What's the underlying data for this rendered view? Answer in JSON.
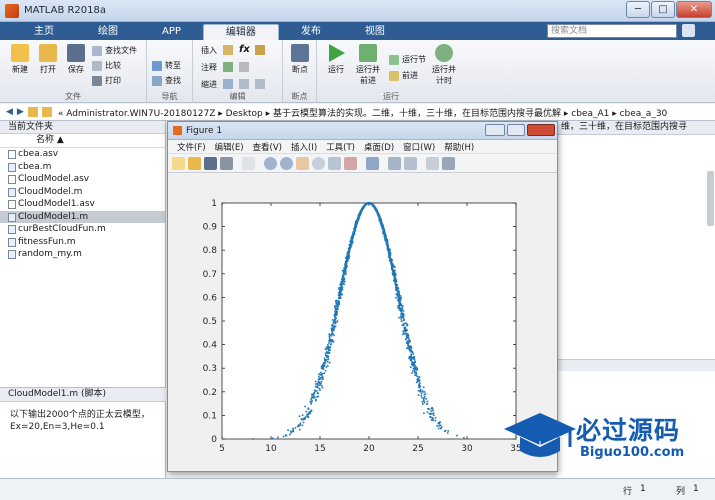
{
  "window": {
    "title": "MATLAB R2018a",
    "minimize": "─",
    "maximize": "□",
    "close": "✕"
  },
  "tabs": [
    "主页",
    "绘图",
    "APP",
    "编辑器",
    "发布",
    "视图"
  ],
  "search": {
    "placeholder": "搜索文档"
  },
  "ribbon": {
    "file": {
      "label": "文件",
      "new": "新建",
      "open": "打开",
      "save": "保存",
      "find_files": "查找文件",
      "compare": "比较",
      "print": "打印"
    },
    "navigate": {
      "label": "导航",
      "goto": "转至",
      "find": "查找"
    },
    "edit": {
      "label": "编辑",
      "insert": "插入",
      "comment": "注释",
      "indent": "缩进",
      "fx": "fx"
    },
    "breakpoints": {
      "label": "断点",
      "breakpoint": "断点"
    },
    "run": {
      "label": "运行",
      "run": "运行",
      "run_advance": "运行并\n前进",
      "run_section": "运行节",
      "advance": "前进",
      "run_time": "运行并\n计时"
    }
  },
  "address": {
    "path": "« Administrator.WIN7U-20180127Z ▸ Desktop ▸ 基于云模型算法的实现。二维，十维，三十维，在目标范围内搜寻最优解 ▸ cbea_A1 ▸ cbea_a_30",
    "behind_text": "维，三十维，在目标范围内搜寻"
  },
  "current_folder": {
    "header": "当前文件夹",
    "column": "名称 ▲",
    "files": [
      "cbea.asv",
      "cbea.m",
      "CloudModel.asv",
      "CloudModel.m",
      "CloudModel1.asv",
      "CloudModel1.m",
      "curBestCloudFun.m",
      "fitnessFun.m",
      "random_my.m"
    ],
    "selected": "CloudModel1.m"
  },
  "details": {
    "header": "CloudModel1.m  (脚本)",
    "text": "以下输出2000个点的正太云模型，Ex=20,En=3,He=0.1"
  },
  "figure": {
    "title": "Figure 1",
    "menu": [
      "文件(F)",
      "编辑(E)",
      "查看(V)",
      "插入(I)",
      "工具(T)",
      "桌面(D)",
      "窗口(W)",
      "帮助(H)"
    ]
  },
  "status": {
    "row_label": "行",
    "row_value": "1",
    "col_label": "列",
    "col_value": "1"
  },
  "watermark": {
    "cn": "必过源码",
    "en": "Biguo100.com"
  },
  "chart_data": {
    "type": "scatter",
    "title": "",
    "xlabel": "",
    "ylabel": "",
    "xlim": [
      5,
      35
    ],
    "ylim": [
      0,
      1
    ],
    "x_ticks": [
      "5",
      "10",
      "15",
      "20",
      "25",
      "30",
      "35"
    ],
    "y_ticks": [
      "0",
      "0.1",
      "0.2",
      "0.3",
      "0.4",
      "0.5",
      "0.6",
      "0.7",
      "0.8",
      "0.9",
      "1"
    ],
    "series_color": "#1f77b4",
    "model": {
      "Ex": 20,
      "En": 3,
      "He": 0.1,
      "points": 2000
    },
    "grid": false
  }
}
